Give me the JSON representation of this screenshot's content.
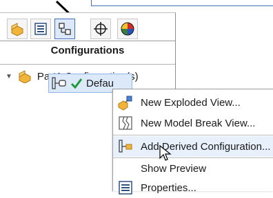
{
  "panel": {
    "heading": "Configurations",
    "tabs": [
      {
        "name": "feature-manager-tab",
        "icon": "part-icon"
      },
      {
        "name": "property-manager-tab",
        "icon": "property-icon"
      },
      {
        "name": "configuration-manager-tab",
        "icon": "configuration-icon",
        "active": true
      },
      {
        "name": "dimxpert-tab",
        "icon": "crosshair-icon"
      },
      {
        "name": "display-manager-tab",
        "icon": "color-sphere-icon"
      }
    ]
  },
  "tree": {
    "root_label": "Part1 Configuration(s)",
    "child_label": "Defau"
  },
  "context_menu": {
    "items": [
      {
        "label": "New Exploded View...",
        "icon": "exploded-view-icon"
      },
      {
        "label": "New Model Break View...",
        "icon": "model-break-view-icon"
      },
      {
        "label": "Add Derived Configuration...",
        "icon": "derived-configuration-icon"
      },
      {
        "label": "Show Preview",
        "icon": ""
      },
      {
        "label": "Properties...",
        "icon": "properties-icon"
      }
    ]
  }
}
